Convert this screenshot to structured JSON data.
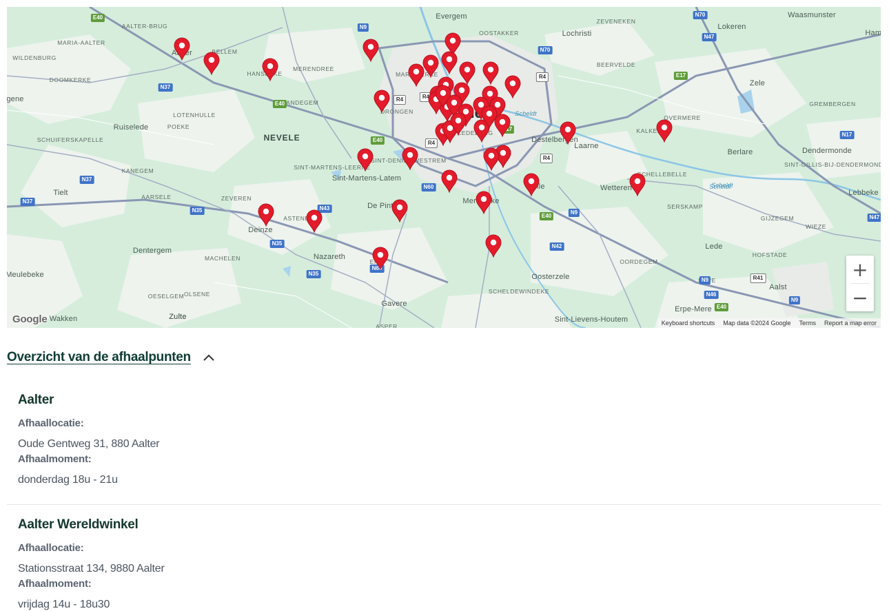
{
  "map": {
    "places": [
      {
        "name": "Evergem",
        "cls": ""
      },
      {
        "name": "Waasmunster",
        "cls": ""
      },
      {
        "name": "Lokeren",
        "cls": ""
      },
      {
        "name": "Hamm",
        "cls": ""
      },
      {
        "name": "AALTER-BRUG",
        "cls": "small"
      },
      {
        "name": "MARIA-AALTER",
        "cls": "small"
      },
      {
        "name": "OOSTAKKER",
        "cls": "small"
      },
      {
        "name": "Lochristi",
        "cls": ""
      },
      {
        "name": "ZEVENEKEN",
        "cls": "small"
      },
      {
        "name": "WILDENBURG",
        "cls": "small"
      },
      {
        "name": "Aalter",
        "cls": ""
      },
      {
        "name": "BELLEM",
        "cls": "small"
      },
      {
        "name": "HANSBEKE",
        "cls": "small"
      },
      {
        "name": "MERENDREE",
        "cls": "small"
      },
      {
        "name": "MARIAKERKE",
        "cls": "small"
      },
      {
        "name": "BEERVELDE",
        "cls": "small"
      },
      {
        "name": "DOOMKERKE",
        "cls": "small"
      },
      {
        "name": "Zele",
        "cls": ""
      },
      {
        "name": "gene",
        "cls": ""
      },
      {
        "name": "LANDEGEM",
        "cls": "small"
      },
      {
        "name": "DRONGEN",
        "cls": "small"
      },
      {
        "name": "GREMBERGEN",
        "cls": "small"
      },
      {
        "name": "LOTENHULLE",
        "cls": "small"
      },
      {
        "name": "Ghent",
        "cls": "city"
      },
      {
        "name": "Ruiselede",
        "cls": ""
      },
      {
        "name": "POEKE",
        "cls": "small"
      },
      {
        "name": "LEDEBERG",
        "cls": "small"
      },
      {
        "name": "KALKEN",
        "cls": "small"
      },
      {
        "name": "OVERMERE",
        "cls": "small"
      },
      {
        "name": "SCHUIFERSKAPELLE",
        "cls": "small"
      },
      {
        "name": "NEVELE",
        "cls": "big"
      },
      {
        "name": "Destelbergen",
        "cls": ""
      },
      {
        "name": "Laarne",
        "cls": ""
      },
      {
        "name": "Berlare",
        "cls": ""
      },
      {
        "name": "Dendermonde",
        "cls": ""
      },
      {
        "name": "SINT-DENIJS-WESTREM",
        "cls": "small"
      },
      {
        "name": "KANEGEM",
        "cls": "small"
      },
      {
        "name": "SINT-MARTENS-LEERNE",
        "cls": "small"
      },
      {
        "name": "SINT-GILLIS-BIJ-DENDERMONDE",
        "cls": "small"
      },
      {
        "name": "Sint-Martens-Latem",
        "cls": ""
      },
      {
        "name": "SCHELLEBELLE",
        "cls": "small"
      },
      {
        "name": "Melle",
        "cls": ""
      },
      {
        "name": "Wetteren",
        "cls": ""
      },
      {
        "name": "Scheldt",
        "cls": "water"
      },
      {
        "name": "Tielt",
        "cls": ""
      },
      {
        "name": "Lebbeke",
        "cls": ""
      },
      {
        "name": "AARSELE",
        "cls": "small"
      },
      {
        "name": "ZEVEREN",
        "cls": "small"
      },
      {
        "name": "De Pinte",
        "cls": ""
      },
      {
        "name": "Merelbeke",
        "cls": ""
      },
      {
        "name": "SERSKAMP",
        "cls": "small"
      },
      {
        "name": "ASTENE",
        "cls": "small"
      },
      {
        "name": "GIJZEGEM",
        "cls": "small"
      },
      {
        "name": "WIEZE",
        "cls": "small"
      },
      {
        "name": "Deinze",
        "cls": ""
      },
      {
        "name": "Lede",
        "cls": ""
      },
      {
        "name": "Dentergem",
        "cls": ""
      },
      {
        "name": "HOFSTADE",
        "cls": "small"
      },
      {
        "name": "Nazareth",
        "cls": ""
      },
      {
        "name": "MACHELEN",
        "cls": "small"
      },
      {
        "name": "EKE",
        "cls": "small"
      },
      {
        "name": "OORDEGEM",
        "cls": "small"
      },
      {
        "name": "Meulebeke",
        "cls": ""
      },
      {
        "name": "Oosterzele",
        "cls": ""
      },
      {
        "name": "ERPE",
        "cls": "small"
      },
      {
        "name": "Aalst",
        "cls": ""
      },
      {
        "name": "OESELGEM",
        "cls": "small"
      },
      {
        "name": "OLSENE",
        "cls": "small"
      },
      {
        "name": "SCHELDEWINDEKE",
        "cls": "small"
      },
      {
        "name": "Gavere",
        "cls": ""
      },
      {
        "name": "Erpe-Mere",
        "cls": ""
      },
      {
        "name": "Zulte",
        "cls": ""
      },
      {
        "name": "Sint-Lievens-Houtem",
        "cls": ""
      },
      {
        "name": "Wakken",
        "cls": ""
      },
      {
        "name": "Zulte",
        "cls": ""
      },
      {
        "name": "ASPER",
        "cls": "small"
      },
      {
        "name": "Scheldt",
        "cls": "water"
      },
      {
        "name": "Scheldt",
        "cls": "water"
      },
      {
        "name": "Ghent",
        "cls": "city"
      }
    ],
    "shields": [
      {
        "label": "E40",
        "kind": "e"
      },
      {
        "label": "N9",
        "kind": "n"
      },
      {
        "label": "N70",
        "kind": "n"
      },
      {
        "label": "N47",
        "kind": "n"
      },
      {
        "label": "N70",
        "kind": "n"
      },
      {
        "label": "R4",
        "kind": "r"
      },
      {
        "label": "N37",
        "kind": "n"
      },
      {
        "label": "E40",
        "kind": "e"
      },
      {
        "label": "R4",
        "kind": "r"
      },
      {
        "label": "E17",
        "kind": "e"
      },
      {
        "label": "R4",
        "kind": "r"
      },
      {
        "label": "E17",
        "kind": "e"
      },
      {
        "label": "N17",
        "kind": "n"
      },
      {
        "label": "E40",
        "kind": "e"
      },
      {
        "label": "R4",
        "kind": "r"
      },
      {
        "label": "R4",
        "kind": "r"
      },
      {
        "label": "N37",
        "kind": "n"
      },
      {
        "label": "N37",
        "kind": "n"
      },
      {
        "label": "N60",
        "kind": "n"
      },
      {
        "label": "N35",
        "kind": "n"
      },
      {
        "label": "N43",
        "kind": "n"
      },
      {
        "label": "E40",
        "kind": "e"
      },
      {
        "label": "N9",
        "kind": "n"
      },
      {
        "label": "N47",
        "kind": "n"
      },
      {
        "label": "N35",
        "kind": "n"
      },
      {
        "label": "N42",
        "kind": "n"
      },
      {
        "label": "N35",
        "kind": "n"
      },
      {
        "label": "N60",
        "kind": "n"
      },
      {
        "label": "N9",
        "kind": "n"
      },
      {
        "label": "R41",
        "kind": "r"
      },
      {
        "label": "N46",
        "kind": "n"
      },
      {
        "label": "E40",
        "kind": "e"
      },
      {
        "label": "N9",
        "kind": "n"
      }
    ],
    "pin_count": 44,
    "pin_color": "#e31b2b",
    "zoom_in_label": "+",
    "zoom_out_label": "−",
    "google_logo": "Google",
    "attribution": {
      "shortcuts": "Keyboard shortcuts",
      "data": "Map data ©2024 Google",
      "terms": "Terms",
      "report": "Report a map error"
    }
  },
  "overview": {
    "title": "Overzicht van de afhaalpunten",
    "chevron_icon": "chevron-up-icon"
  },
  "entries": [
    {
      "name": "Aalter",
      "location_label": "Afhaallocatie:",
      "location": "Oude Gentweg 31, 880 Aalter",
      "moment_label": "Afhaalmoment:",
      "moment": "donderdag 18u - 21u"
    },
    {
      "name": "Aalter Wereldwinkel",
      "location_label": "Afhaallocatie:",
      "location": "Stationsstraat 134, 9880 Aalter",
      "moment_label": "Afhaalmoment:",
      "moment": "vrijdag 14u - 18u30"
    }
  ]
}
